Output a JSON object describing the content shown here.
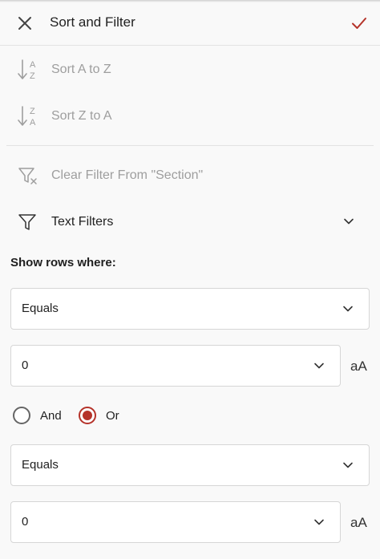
{
  "header": {
    "title": "Sort and Filter"
  },
  "actions": {
    "sort_asc": "Sort A to Z",
    "sort_desc": "Sort Z to A",
    "clear_filter": "Clear Filter From \"Section\"",
    "text_filters": "Text Filters"
  },
  "icons": {
    "sort_asc_top": "A",
    "sort_asc_bottom": "Z",
    "sort_desc_top": "Z",
    "sort_desc_bottom": "A"
  },
  "show_rows": {
    "title": "Show rows where:",
    "condition1": {
      "operator": "Equals",
      "value": "0"
    },
    "condition2": {
      "operator": "Equals",
      "value": "0"
    },
    "match_case_label": "aA",
    "logic": {
      "and_label": "And",
      "or_label": "Or",
      "selected": "Or"
    }
  },
  "colors": {
    "accent": "#b5332a",
    "disabled_text": "#9e9e9e"
  }
}
